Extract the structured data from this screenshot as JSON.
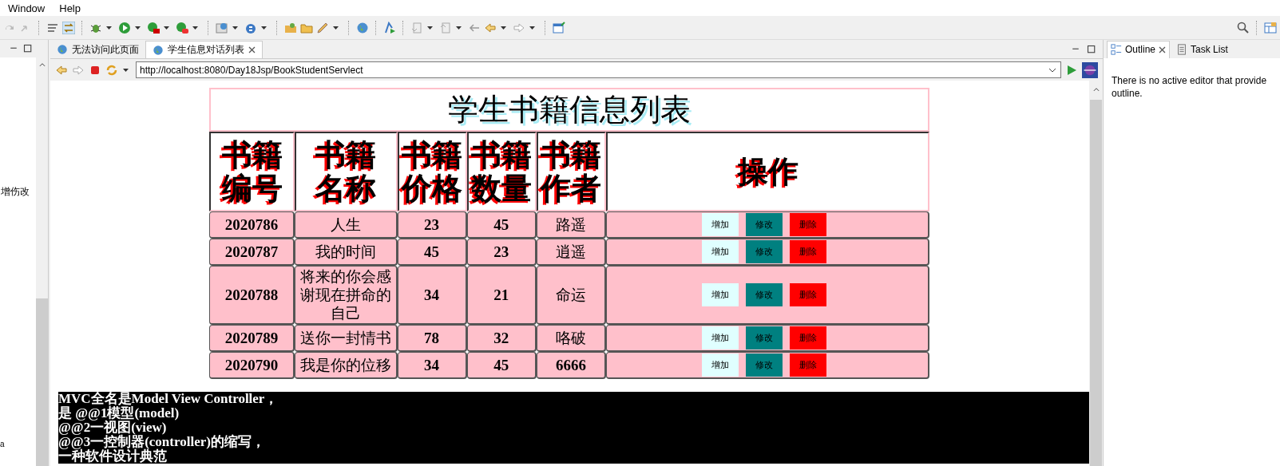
{
  "menu": [
    "Window",
    "Help"
  ],
  "left_panel": {
    "text": "增伤改",
    "footer": "a"
  },
  "editor_tabs": [
    {
      "label": "无法访问此页面",
      "selected": false,
      "closable": false
    },
    {
      "label": "学生信息对话列表",
      "selected": true,
      "closable": true
    }
  ],
  "address": {
    "value": "http://localhost:8080/Day18Jsp/BookStudentServlect"
  },
  "page": {
    "title": "学生书籍信息列表",
    "columns": [
      "书籍编号",
      "书籍名称",
      "书籍价格",
      "书籍数量",
      "书籍作者",
      "操作"
    ],
    "rows": [
      {
        "cells": [
          "2020786",
          "人生",
          "23",
          "45",
          "路遥"
        ],
        "actions": [
          "增加",
          "修改",
          "删除"
        ]
      },
      {
        "cells": [
          "2020787",
          "我的时间",
          "45",
          "23",
          "逍遥"
        ],
        "actions": [
          "增加",
          "修改",
          "删除"
        ]
      },
      {
        "cells": [
          "2020788",
          "将来的你会感谢现在拼命的自己",
          "34",
          "21",
          "命运"
        ],
        "actions": [
          "增加",
          "修改",
          "删除"
        ]
      },
      {
        "cells": [
          "2020789",
          "送你一封情书",
          "78",
          "32",
          "咯破"
        ],
        "actions": [
          "增加",
          "修改",
          "删除"
        ]
      },
      {
        "cells": [
          "2020790",
          "我是你的位移",
          "34",
          "45",
          "6666"
        ],
        "actions": [
          "增加",
          "修改",
          "删除"
        ]
      }
    ],
    "notes": [
      "MVC全名是Model View Controller，",
      "是 @@1模型(model)",
      "@@2一视图(view)",
      "@@3一控制器(controller)的缩写，",
      "一种软件设计典范"
    ]
  },
  "side_tabs": [
    {
      "label": "Outline",
      "selected": true,
      "closable": true
    },
    {
      "label": "Task List",
      "selected": false,
      "closable": false
    }
  ],
  "outline_message": "There is no active editor that provide outline."
}
